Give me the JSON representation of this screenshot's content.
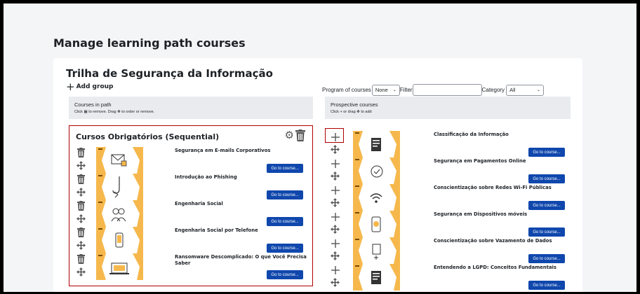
{
  "page_title": "Manage learning path courses",
  "path_title": "Trilha de Segurança da Informação",
  "add_group_label": "Add group",
  "filters": {
    "program_label": "Program of courses",
    "program_value": "None",
    "filter_label": "Filter",
    "filter_value": "",
    "category_label": "Category",
    "category_value": "All"
  },
  "courses_in_path": {
    "title": "Courses in path",
    "hint_pre": "Click",
    "hint_mid": "to remove. Drag",
    "hint_post": "to order or remove."
  },
  "prospective": {
    "title": "Prospective courses",
    "hint_pre": "Click",
    "hint_mid": "or drag",
    "hint_post": "to add"
  },
  "group": {
    "title": "Cursos Obrigatórios (Sequential)",
    "icons": [
      "gear-icon",
      "trash-icon"
    ]
  },
  "goto_label": "Go to course...",
  "path_courses": [
    {
      "name": "Segurança em E-mails Corporativos",
      "icon": "email-icon"
    },
    {
      "name": "Introdução ao Phishing",
      "icon": "hook-icon"
    },
    {
      "name": "Engenharia Social",
      "icon": "people-icon"
    },
    {
      "name": "Engenharia Social por Telefone",
      "icon": "phone-icon"
    },
    {
      "name": "Ransomware Descomplicado: O que Você Precisa Saber",
      "icon": "laptop-icon"
    }
  ],
  "prospective_courses": [
    {
      "name": "Classificação da Informação",
      "icon": "document-icon"
    },
    {
      "name": "Segurança em Pagamentos Online",
      "icon": "card-icon"
    },
    {
      "name": "Conscientização sobre Redes Wi-Fi Públicas",
      "icon": "wifi-icon"
    },
    {
      "name": "Segurança em Dispositivos móveis",
      "icon": "mobile-icon"
    },
    {
      "name": "Conscientização sobre Vazamento de Dados",
      "icon": "data-leak-icon"
    },
    {
      "name": "Entendendo a LGPD: Conceitos Fundamentais",
      "icon": "document-icon"
    }
  ],
  "colors": {
    "accent": "#0f47ad",
    "thumb_orange": "#f6b84c",
    "selection": "#b00000"
  }
}
